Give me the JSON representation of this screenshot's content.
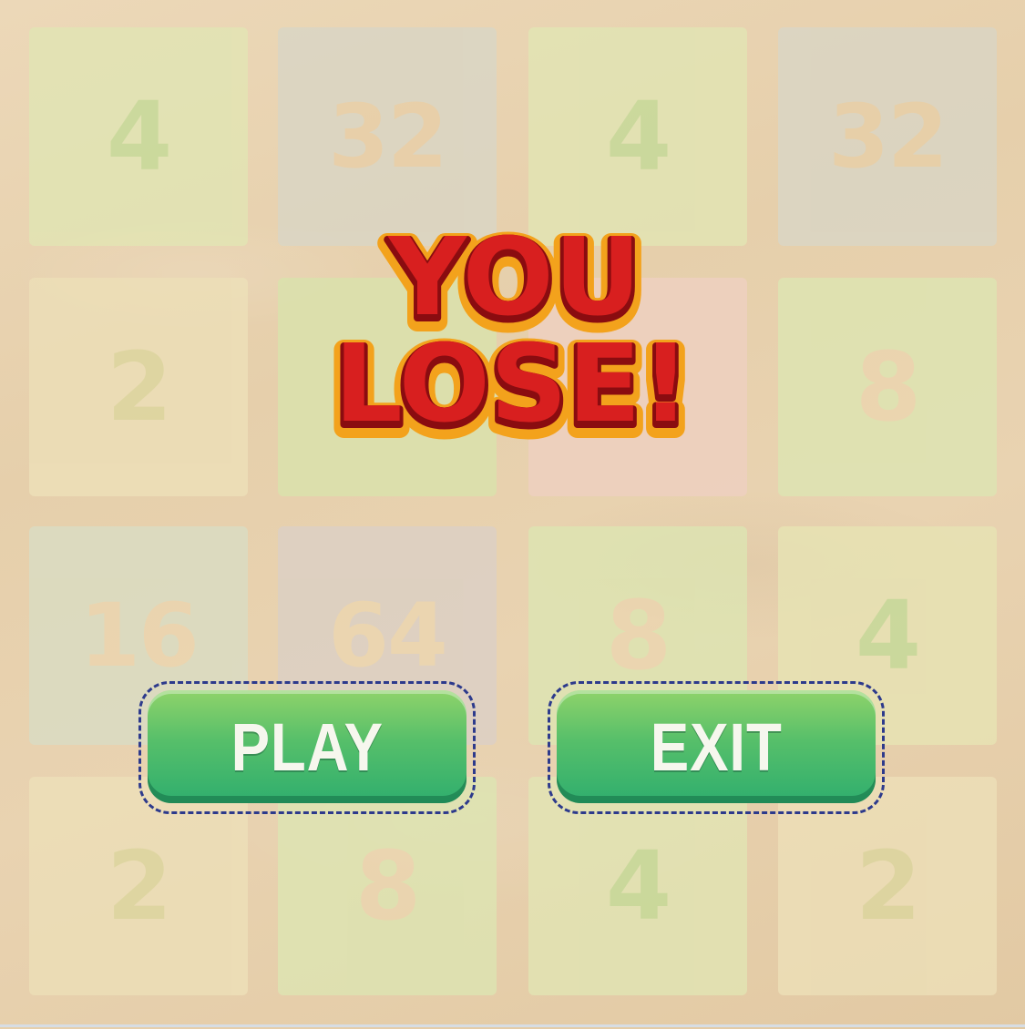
{
  "board": {
    "rows": [
      [
        {
          "value": "4",
          "bg": "#e1e6b4",
          "fg": "#c3db97"
        },
        {
          "value": "32",
          "bg": "#d9d6c6",
          "fg": "#e8cfa8"
        },
        {
          "value": "4",
          "bg": "#e1e6b4",
          "fg": "#c3db97"
        },
        {
          "value": "32",
          "bg": "#d9d6c6",
          "fg": "#e8cfa8"
        }
      ],
      [
        {
          "value": "2",
          "bg": "#ede0b8",
          "fg": "#dcd79e"
        },
        {
          "value": "",
          "bg": "#d8e3ac",
          "fg": "#c3db97"
        },
        {
          "value": "",
          "bg": "#eed0c2",
          "fg": "#e8cfa8"
        },
        {
          "value": "8",
          "bg": "#dde6b2",
          "fg": "#ecd6b0"
        }
      ],
      [
        {
          "value": "16",
          "bg": "#d9ddc4",
          "fg": "#ecd6b0"
        },
        {
          "value": "64",
          "bg": "#dbd0c6",
          "fg": "#ecd6b0"
        },
        {
          "value": "8",
          "bg": "#dde6b2",
          "fg": "#ecd6b0"
        },
        {
          "value": "4",
          "bg": "#e7e4b4",
          "fg": "#c3db97"
        }
      ],
      [
        {
          "value": "2",
          "bg": "#ede0b8",
          "fg": "#dcd79e"
        },
        {
          "value": "8",
          "bg": "#dde6b2",
          "fg": "#ecd6b0"
        },
        {
          "value": "4",
          "bg": "#e1e6b4",
          "fg": "#c3db97"
        },
        {
          "value": "2",
          "bg": "#ede0b8",
          "fg": "#dcd79e"
        }
      ]
    ]
  },
  "game_over": {
    "line1": "YOU",
    "line2": "LOSE!",
    "colors": {
      "fill": "#d81f1f",
      "dark": "#8a0c10",
      "outline": "#f3a21c"
    }
  },
  "buttons": {
    "play_label": "PLAY",
    "exit_label": "EXIT"
  }
}
